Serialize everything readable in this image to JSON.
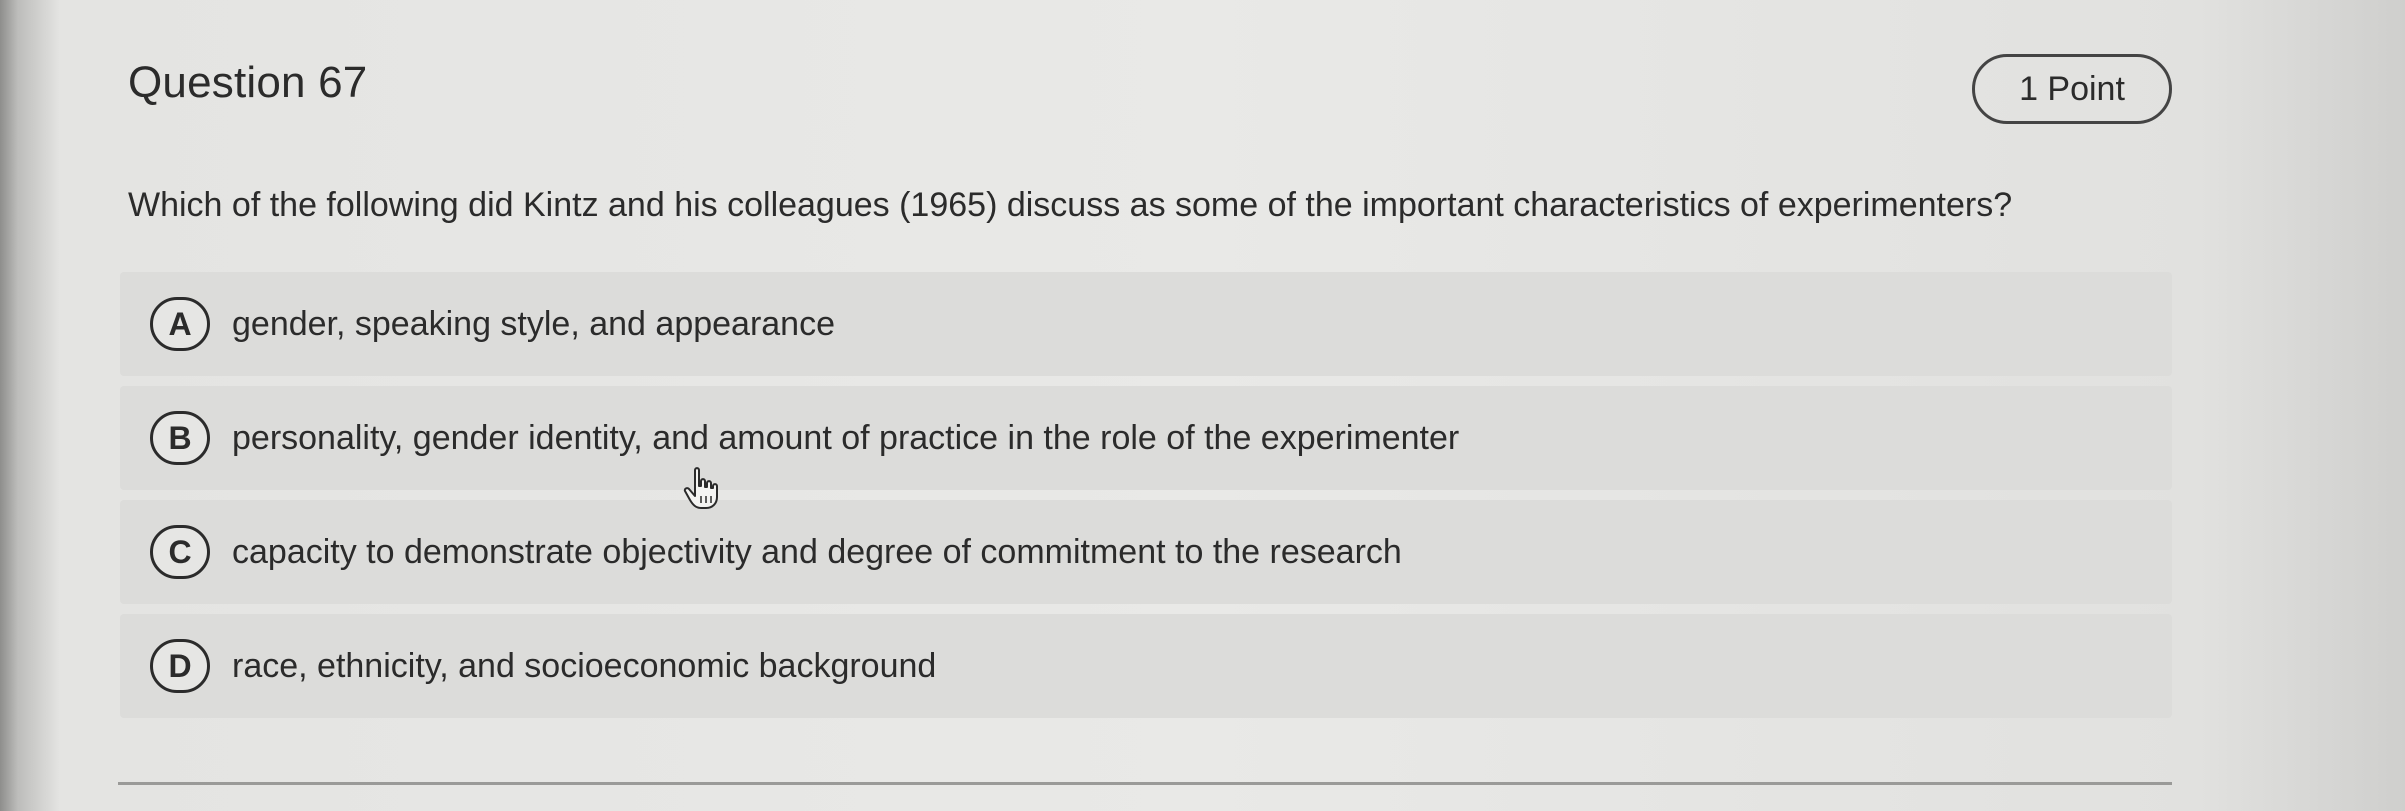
{
  "question": {
    "title": "Question 67",
    "points": "1 Point",
    "text": "Which of the following did Kintz and his colleagues (1965) discuss as some of the important characteristics of experimenters?"
  },
  "options": [
    {
      "letter": "A",
      "text": "gender, speaking style, and appearance"
    },
    {
      "letter": "B",
      "text": "personality, gender identity, and amount of practice in the role of the experimenter"
    },
    {
      "letter": "C",
      "text": "capacity to demonstrate objectivity and degree of commitment to the research"
    },
    {
      "letter": "D",
      "text": "race, ethnicity, and socioeconomic background"
    }
  ],
  "icons": {
    "cursor": "hand-pointer-icon"
  }
}
